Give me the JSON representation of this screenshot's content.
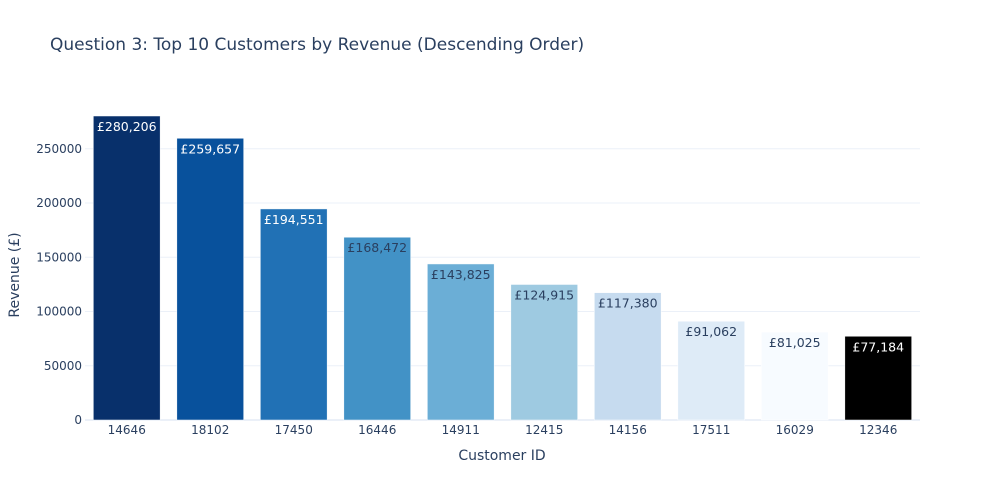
{
  "chart_data": {
    "type": "bar",
    "title": "Question 3: Top 10 Customers by Revenue (Descending Order)",
    "xlabel": "Customer ID",
    "ylabel": "Revenue (£)",
    "categories": [
      "14646",
      "18102",
      "17450",
      "16446",
      "14911",
      "12415",
      "14156",
      "17511",
      "16029",
      "12346"
    ],
    "values": [
      280206,
      259657,
      194551,
      168472,
      143825,
      124915,
      117380,
      91062,
      81025,
      77184
    ],
    "data_labels": [
      "£280,206",
      "£259,657",
      "£194,551",
      "£168,472",
      "£143,825",
      "£124,915",
      "£117,380",
      "£91,062",
      "£81,025",
      "£77,184"
    ],
    "colors": [
      "#08306b",
      "#08519c",
      "#2171b5",
      "#4292c6",
      "#6baed6",
      "#9ecae1",
      "#c6dbef",
      "#deebf7",
      "#f7fbff",
      "#000000"
    ],
    "label_colors": [
      "#ffffff",
      "#ffffff",
      "#ffffff",
      "#2a3f5f",
      "#2a3f5f",
      "#2a3f5f",
      "#2a3f5f",
      "#2a3f5f",
      "#2a3f5f",
      "#ffffff"
    ],
    "yticks": [
      0,
      50000,
      100000,
      150000,
      200000,
      250000
    ],
    "ytick_labels": [
      "0",
      "50000",
      "100000",
      "150000",
      "200000",
      "250000"
    ],
    "ylim": [
      0,
      280206
    ],
    "grid": true,
    "legend": "none"
  }
}
